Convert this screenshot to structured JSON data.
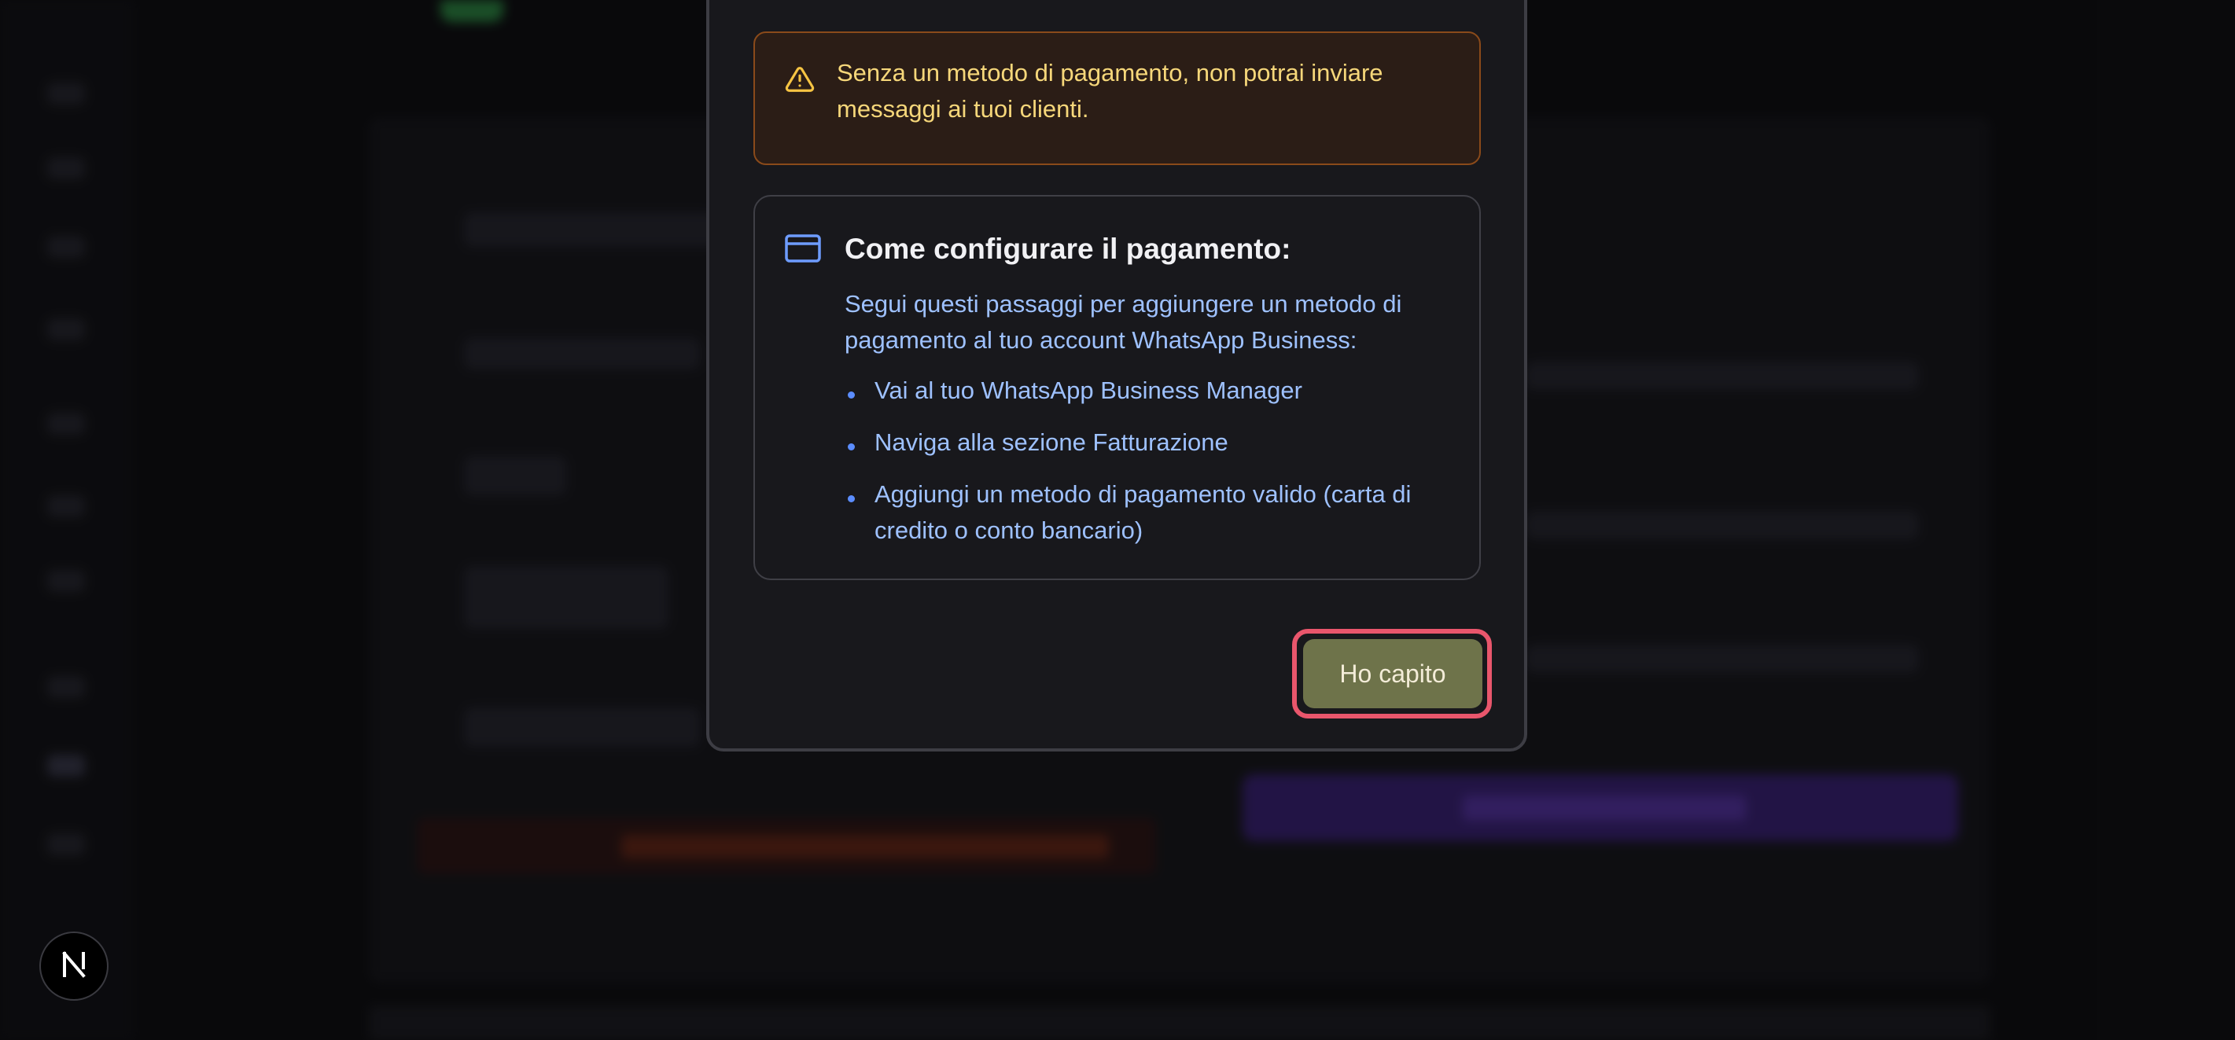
{
  "modal": {
    "warning": {
      "icon": "warning-triangle-icon",
      "text": "Senza un metodo di pagamento, non potrai inviare messaggi ai tuoi clienti."
    },
    "info": {
      "icon": "credit-card-icon",
      "title": "Come configurare il pagamento:",
      "description": "Segui questi passaggi per aggiungere un metodo di pagamento al tuo account WhatsApp Business:",
      "steps": [
        "Vai al tuo WhatsApp Business Manager",
        "Naviga alla sezione Fatturazione",
        "Aggiungi un metodo di pagamento valido (carta di credito o conto bancario)"
      ]
    },
    "confirm_button_label": "Ho capito"
  },
  "badge": {
    "icon": "nextjs-logo-icon",
    "letter": "N"
  },
  "colors": {
    "warning_text": "#f6d77a",
    "warning_border": "#8a4a1a",
    "info_text": "#9ec1ff",
    "button_bg": "#6e734a",
    "focus_ring": "#e9566c",
    "modal_bg": "#18181c"
  }
}
